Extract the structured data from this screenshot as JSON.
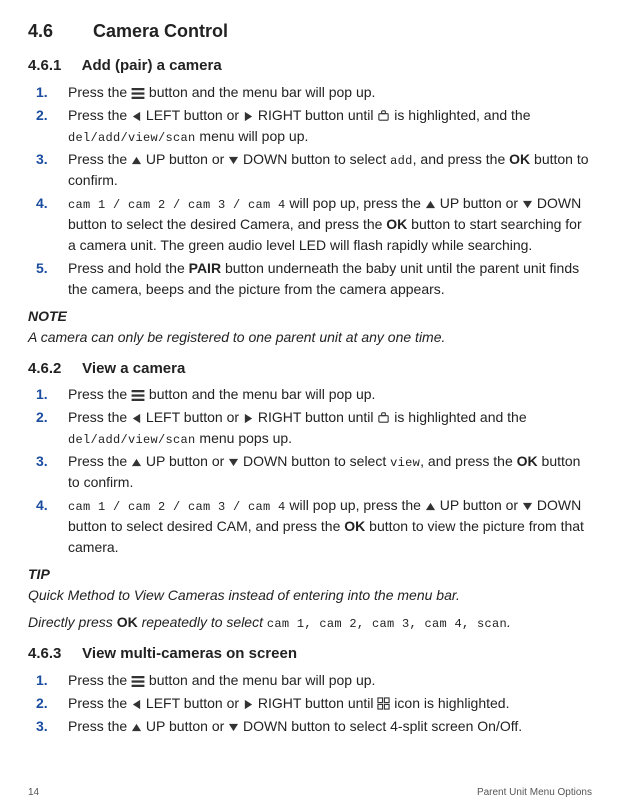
{
  "section": {
    "num": "4.6",
    "title": "Camera Control"
  },
  "s461": {
    "num": "4.6.1",
    "title": "Add (pair) a camera",
    "items": [
      {
        "n": "1.",
        "t1": "Press the ",
        "t2": " button and the menu bar will pop up."
      },
      {
        "n": "2.",
        "t1": "Press the ",
        "left": " LEFT button or ",
        "right": " RIGHT button until ",
        "t2": " is highlighted, and the ",
        "menu": "del/add/view/scan",
        "t3": " menu will pop up."
      },
      {
        "n": "3.",
        "t1": "Press the ",
        "up": " UP button or ",
        "down": " DOWN button to select ",
        "word": "add",
        "t2": ", and press the ",
        "ok": "OK",
        "t3": " button to confirm."
      },
      {
        "n": "4.",
        "cams": "cam 1 / cam 2 / cam 3 / cam 4",
        "t1": " will pop up, press the ",
        "up": " UP button or ",
        "down": " DOWN button to select the desired Camera, and press the ",
        "ok": "OK",
        "t2": " button to start searching for a camera unit. The green audio level LED will flash rapidly while searching."
      },
      {
        "n": "5.",
        "t1": "Press and hold the ",
        "pair": "PAIR",
        "t2": " button underneath the baby unit until the parent unit finds the camera, beeps and the picture from the camera appears."
      }
    ],
    "note_label": "NOTE",
    "note": "A camera can only be registered to one parent unit at any one time."
  },
  "s462": {
    "num": "4.6.2",
    "title": "View a camera",
    "items": [
      {
        "n": "1.",
        "t1": "Press the ",
        "t2": " button and the menu bar will pop up."
      },
      {
        "n": "2.",
        "t1": "Press the ",
        "left": " LEFT button or ",
        "right": " RIGHT button until ",
        "t2": " is highlighted and the ",
        "menu": "del/add/view/scan",
        "t3": " menu pops up."
      },
      {
        "n": "3.",
        "t1": "Press the ",
        "up": " UP button or ",
        "down": " DOWN button to select ",
        "word": "view",
        "t2": ", and press the ",
        "ok": "OK",
        "t3": " button to confirm."
      },
      {
        "n": "4.",
        "cams": "cam 1 / cam 2 / cam 3 / cam 4",
        "t1": " will pop up, press the ",
        "up": " UP button or ",
        "down": " DOWN button to select desired CAM, and press the ",
        "ok": "OK",
        "t2": " button to view the picture from that camera."
      }
    ],
    "tip_label": "TIP",
    "tip1": "Quick Method to View Cameras instead of entering into the menu bar.",
    "tip2a": "Directly press ",
    "tip2_ok": "OK",
    "tip2b": " repeatedly to select ",
    "tip2_cams": [
      "cam 1",
      "cam 2",
      "cam 3",
      "cam 4",
      "scan"
    ],
    "tip2c": "."
  },
  "s463": {
    "num": "4.6.3",
    "title": "View multi-cameras on screen",
    "items": [
      {
        "n": "1.",
        "t1": "Press the ",
        "t2": " button and the menu bar will pop up."
      },
      {
        "n": "2.",
        "t1": "Press the ",
        "left": " LEFT button or ",
        "right": " RIGHT button until ",
        "t2": " icon is highlighted."
      },
      {
        "n": "3.",
        "t1": "Press the ",
        "up": " UP button or ",
        "down": " DOWN button to select 4-split screen On/Off."
      }
    ]
  },
  "footer": {
    "page": "14",
    "label": "Parent Unit Menu Options"
  }
}
